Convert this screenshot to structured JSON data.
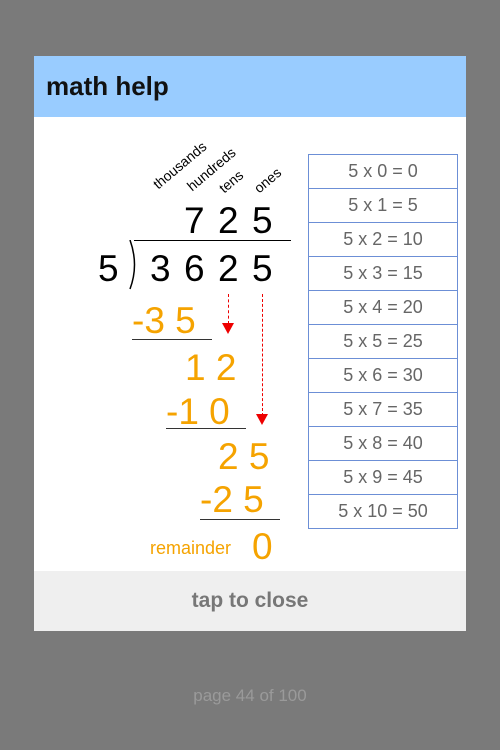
{
  "dialog": {
    "title": "math help",
    "place_values": [
      "thousands",
      "hundreds",
      "tens",
      "ones"
    ],
    "quotient": [
      "7",
      "2",
      "5"
    ],
    "divisor": "5",
    "dividend": [
      "3",
      "6",
      "2",
      "5"
    ],
    "steps": {
      "s1": "-3 5",
      "s2": "1 2",
      "s3": "-1 0",
      "s4": "2 5",
      "s5": "-2 5"
    },
    "remainder_label": "remainder",
    "remainder_value": "0",
    "times_table": [
      "5 x 0 = 0",
      "5 x 1 = 5",
      "5 x 2 = 10",
      "5 x 3 = 15",
      "5 x 4 = 20",
      "5 x 5 = 25",
      "5 x 6 = 30",
      "5 x 7 = 35",
      "5 x 8 = 40",
      "5 x 9 = 45",
      "5 x 10 = 50"
    ],
    "close_label": "tap to close"
  },
  "footer": {
    "page_indicator": "page 44 of 100"
  },
  "colors": {
    "header_bg": "#99ccff",
    "step_orange": "#f5a300",
    "arrow_red": "#e00000",
    "table_border": "#6c8fd6",
    "backdrop": "#7a7a7a"
  }
}
